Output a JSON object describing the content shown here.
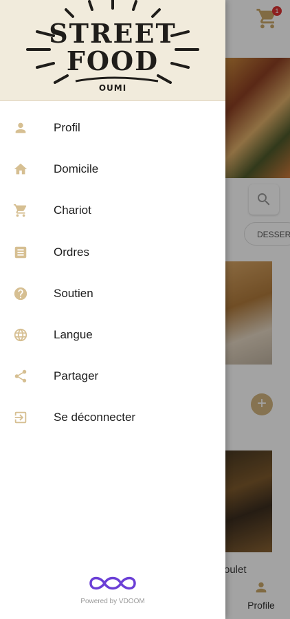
{
  "background": {
    "cart_badge": "1",
    "category_chip": "DESSER",
    "food_item_title": "oulet",
    "bottom_tab_label": "Profile"
  },
  "drawer": {
    "logo": {
      "line1": "STREET",
      "line2": "FOOD",
      "sub": "OUMI"
    },
    "menu": [
      {
        "label": "Profil",
        "icon": "person-icon"
      },
      {
        "label": "Domicile",
        "icon": "home-icon"
      },
      {
        "label": "Chariot",
        "icon": "cart-icon"
      },
      {
        "label": "Ordres",
        "icon": "list-icon"
      },
      {
        "label": "Soutien",
        "icon": "help-icon"
      },
      {
        "label": "Langue",
        "icon": "globe-icon"
      },
      {
        "label": "Partager",
        "icon": "share-icon"
      },
      {
        "label": "Se déconnecter",
        "icon": "logout-icon"
      }
    ],
    "powered_by": "Powered by VDOOM"
  },
  "colors": {
    "accent": "#d6bf92",
    "header_bg": "#f1ebdc",
    "brand_purple": "#6b3fd6"
  }
}
